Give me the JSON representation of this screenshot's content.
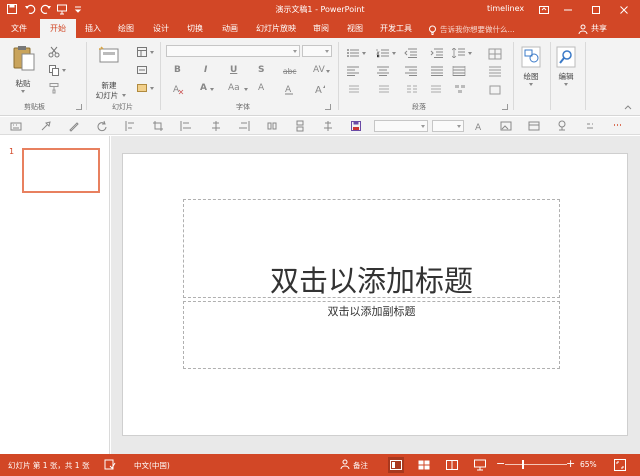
{
  "window": {
    "title": "演示文稿1 - PowerPoint",
    "user": "timelinex",
    "brand_color": "#d24726"
  },
  "tabs": [
    {
      "label": "文件",
      "active": false
    },
    {
      "label": "开始",
      "active": true
    },
    {
      "label": "插入",
      "active": false
    },
    {
      "label": "绘图",
      "active": false
    },
    {
      "label": "设计",
      "active": false
    },
    {
      "label": "切换",
      "active": false
    },
    {
      "label": "动画",
      "active": false
    },
    {
      "label": "幻灯片放映",
      "active": false
    },
    {
      "label": "审阅",
      "active": false
    },
    {
      "label": "视图",
      "active": false
    },
    {
      "label": "开发工具",
      "active": false
    }
  ],
  "tellme": {
    "text": "告诉我你想要做什么..."
  },
  "share": {
    "label": "共享"
  },
  "ribbon": {
    "clipboard": {
      "label": "剪贴板",
      "paste_label": "粘贴"
    },
    "slides": {
      "label": "幻灯片",
      "new_slide_label_1": "新建",
      "new_slide_label_2": "幻灯片"
    },
    "font": {
      "label": "字体",
      "glyphs": [
        "B",
        "I",
        "U",
        "S",
        "abc",
        "AV",
        "A",
        "Aa",
        "A"
      ]
    },
    "paragraph": {
      "label": "段落"
    },
    "drawing": {
      "label": "绘图"
    },
    "editing": {
      "label": "编辑"
    }
  },
  "thumbnails": {
    "slide_number": "1"
  },
  "slide": {
    "title_placeholder": "双击以添加标题",
    "subtitle_placeholder": "双击以添加副标题"
  },
  "status": {
    "slide_info": "幻灯片 第 1 张，共 1 张",
    "language": "中文(中国)",
    "notes_label": "备注",
    "zoom": "65%"
  }
}
